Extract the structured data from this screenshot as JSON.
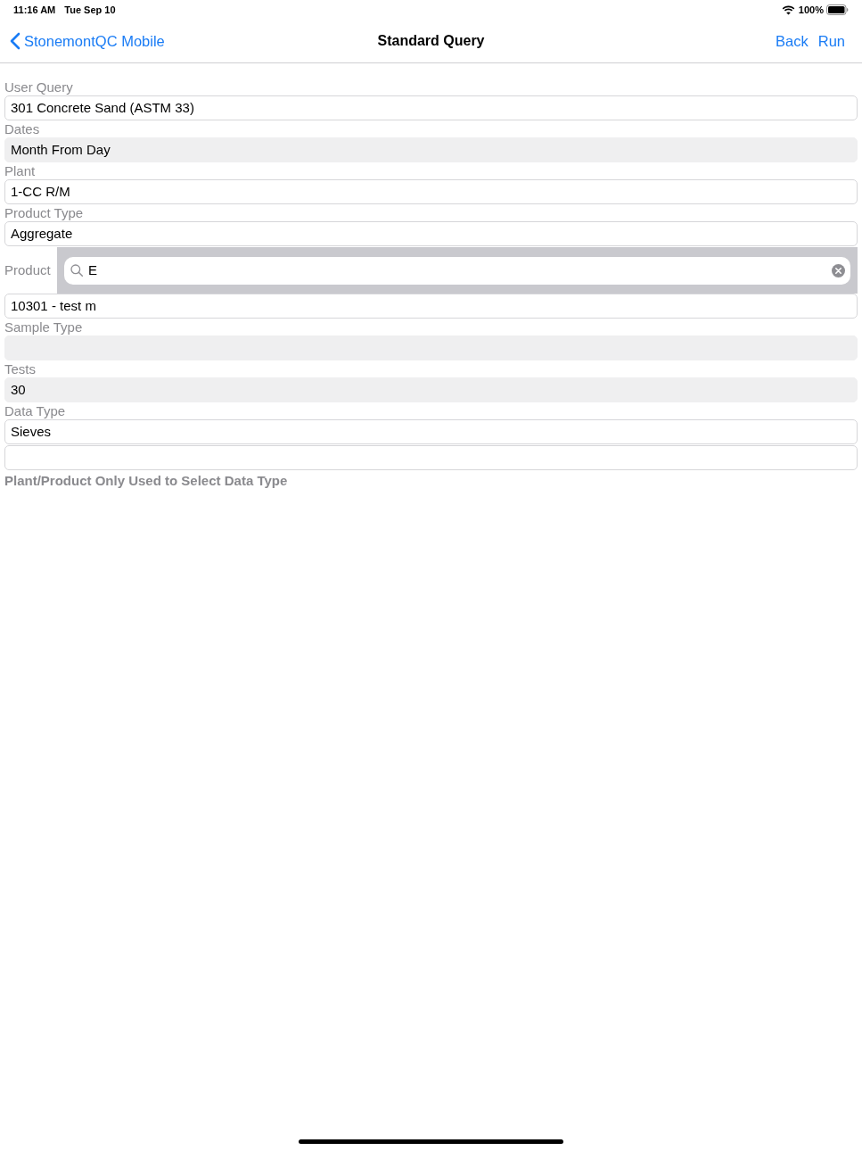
{
  "status_bar": {
    "time": "11:16 AM",
    "date": "Tue Sep 10",
    "battery": "100%"
  },
  "nav_bar": {
    "back_link": "StonemontQC Mobile",
    "title": "Standard Query",
    "buttons": [
      "Back",
      "Run"
    ]
  },
  "form": [
    {
      "kind": "field",
      "label": "User Query",
      "value": "301 Concrete Sand (ASTM 33)",
      "disabled": false
    },
    {
      "kind": "field",
      "label": "Dates",
      "value": "Month From Day",
      "disabled": true
    },
    {
      "kind": "field",
      "label": "Plant",
      "value": "1-CC R/M",
      "disabled": false
    },
    {
      "kind": "field",
      "label": "Product Type",
      "value": "Aggregate",
      "disabled": false
    },
    {
      "kind": "search",
      "label": "Product",
      "value": "E"
    },
    {
      "kind": "field",
      "value": "10301 - test m",
      "disabled": false
    },
    {
      "kind": "field",
      "label": "Sample Type",
      "disabled": true
    },
    {
      "kind": "field",
      "label": "Tests",
      "value": "30",
      "disabled": true
    },
    {
      "kind": "field",
      "label": "Data Type",
      "value": "Sieves",
      "disabled": false
    },
    {
      "kind": "field",
      "disabled": false
    }
  ],
  "footnote": "Plant/Product Only Used to Select Data Type"
}
